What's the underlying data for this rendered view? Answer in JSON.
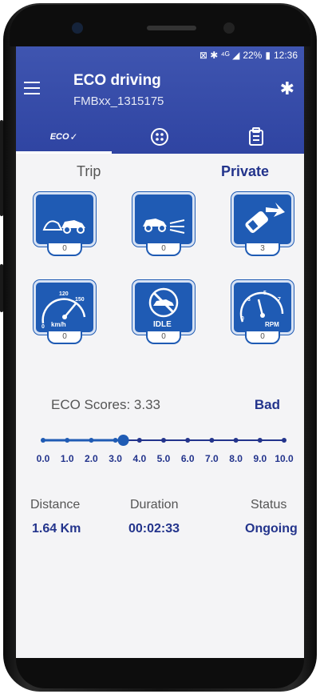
{
  "status_bar": {
    "icons": "⊠ ✱ ⁴ᴳ ◢",
    "battery": "22%",
    "time": "12:36"
  },
  "header": {
    "title": "ECO driving",
    "subtitle": "FMBxx_1315175",
    "tab_eco_label": "ECO"
  },
  "mode": {
    "trip_label": "Trip",
    "private_label": "Private"
  },
  "events": [
    {
      "name": "harsh-acceleration",
      "count": "0"
    },
    {
      "name": "harsh-braking",
      "count": "0"
    },
    {
      "name": "harsh-cornering",
      "count": "3"
    },
    {
      "name": "overspeeding",
      "count": "0",
      "unit": "km/h",
      "marks": [
        "0",
        "120",
        "150"
      ]
    },
    {
      "name": "idling",
      "count": "0",
      "label": "IDLE"
    },
    {
      "name": "over-rpm",
      "count": "0",
      "label": "RPM",
      "marks": [
        "0",
        "3",
        "5",
        "7"
      ]
    }
  ],
  "eco": {
    "label": "ECO Scores: 3.33",
    "rating": "Bad",
    "score": 3.33,
    "scale": [
      "0.0",
      "1.0",
      "2.0",
      "3.0",
      "4.0",
      "5.0",
      "6.0",
      "7.0",
      "8.0",
      "9.0",
      "10.0"
    ]
  },
  "stats": {
    "distance_label": "Distance",
    "distance_value": "1.64 Km",
    "duration_label": "Duration",
    "duration_value": "00:02:33",
    "status_label": "Status",
    "status_value": "Ongoing"
  },
  "colors": {
    "primary": "#3346a6",
    "accent": "#1f5bb4",
    "text_dark": "#23348c"
  }
}
